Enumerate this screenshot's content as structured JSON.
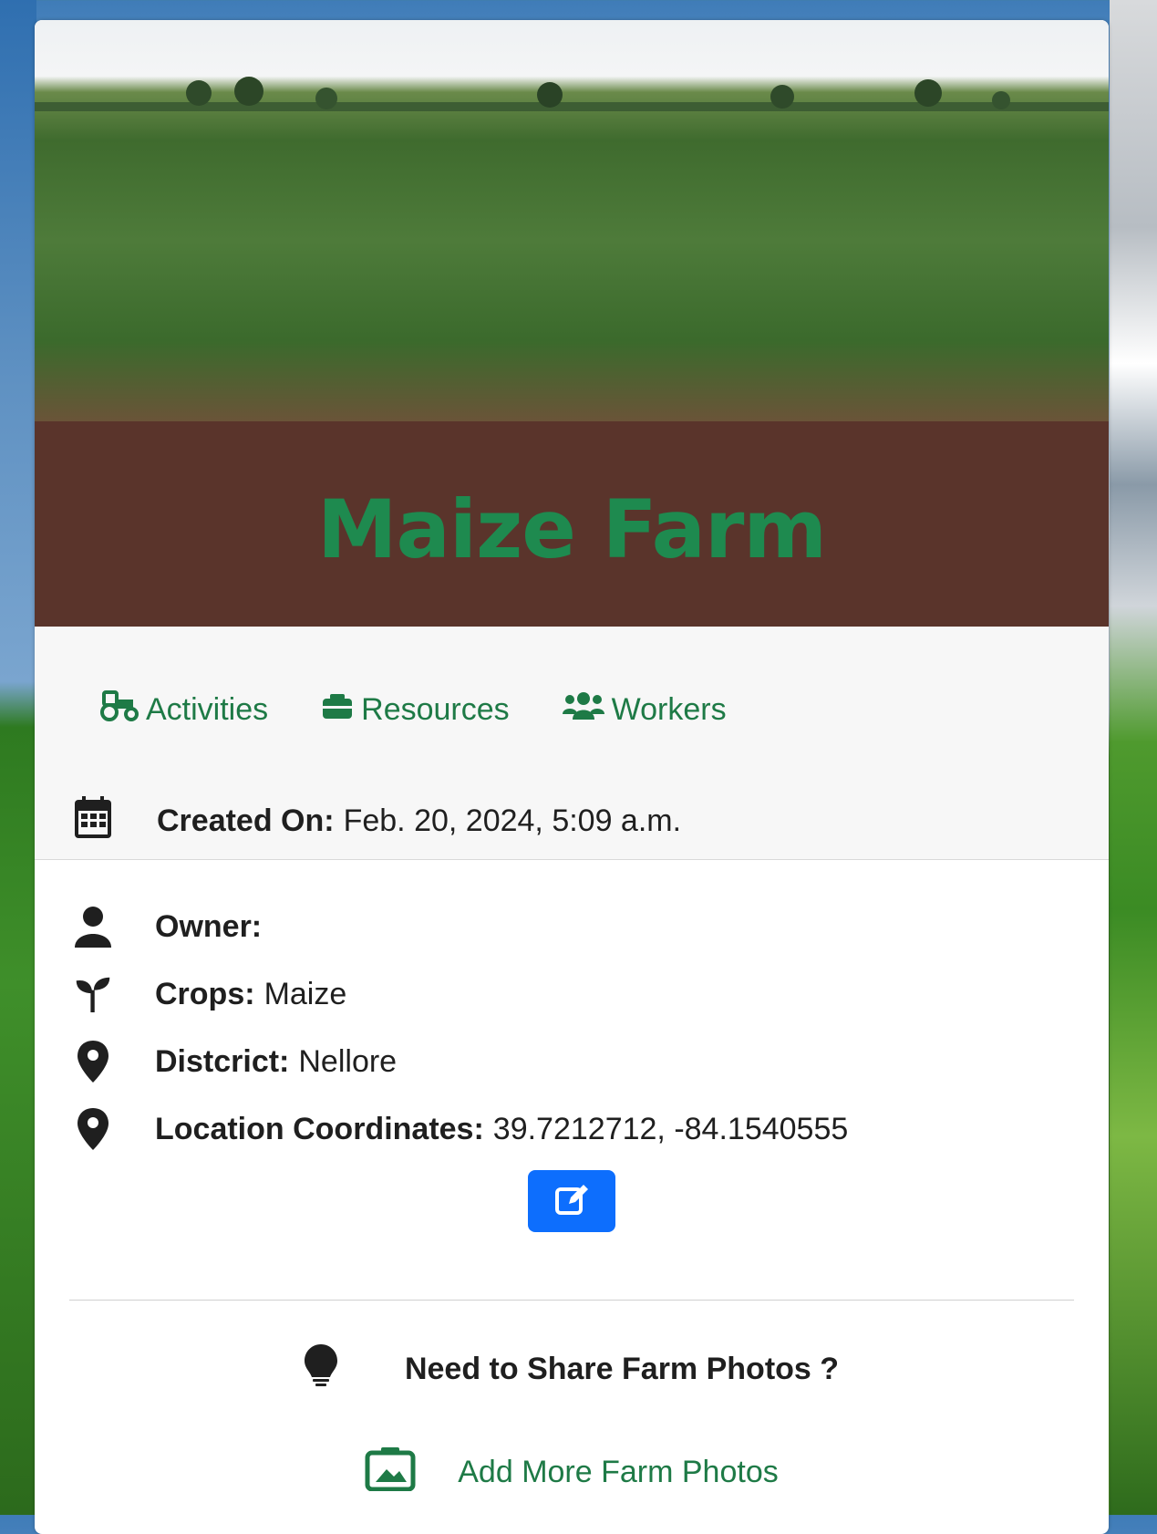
{
  "farm": {
    "title": "Maize Farm",
    "tabs": [
      {
        "label": "Activities",
        "icon": "tractor-icon"
      },
      {
        "label": "Resources",
        "icon": "toolbox-icon"
      },
      {
        "label": "Workers",
        "icon": "users-icon"
      }
    ],
    "created": {
      "label": "Created On:",
      "value": "Feb. 20, 2024, 5:09 a.m."
    },
    "details": [
      {
        "label": "Owner:",
        "value": "",
        "icon": "user-icon"
      },
      {
        "label": "Crops:",
        "value": "Maize",
        "icon": "seedling-icon"
      },
      {
        "label": "Distcrict:",
        "value": "Nellore",
        "icon": "location-pin-icon"
      },
      {
        "label": "Location Coordinates:",
        "value": "39.7212712, -84.1540555",
        "icon": "location-pin-icon"
      }
    ],
    "share": {
      "prompt": "Need to Share Farm Photos ?",
      "action": "Add More Farm Photos"
    }
  },
  "colors": {
    "accent_green": "#1e8a4f",
    "band_brown": "#5a342b",
    "button_blue": "#0d6efd"
  }
}
